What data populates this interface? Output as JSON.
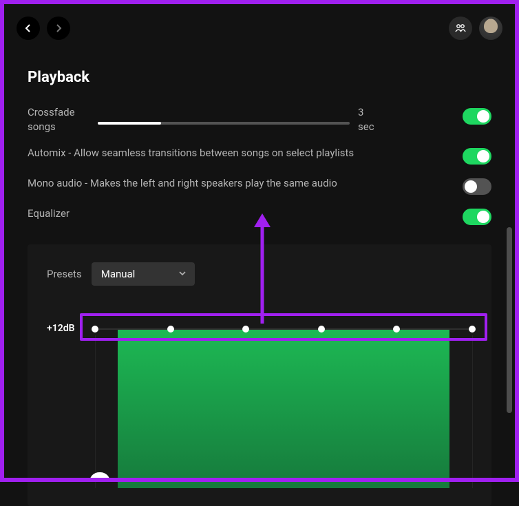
{
  "colors": {
    "accent": "#1ed760",
    "highlight": "#a020f0"
  },
  "playback": {
    "title": "Playback",
    "crossfade": {
      "label": "Crossfade songs",
      "value_text": "3",
      "unit": "sec",
      "value": 3,
      "min": 0,
      "max": 12
    },
    "automix": {
      "label": "Automix - Allow seamless transitions between songs on select playlists",
      "enabled": true
    },
    "mono": {
      "label": "Mono audio - Makes the left and right speakers play the same audio",
      "enabled": false
    },
    "equalizer": {
      "label": "Equalizer",
      "enabled": true,
      "presets_label": "Presets",
      "preset_selected": "Manual",
      "db_top_label": "+12dB",
      "bands": [
        {
          "gain_db": 12
        },
        {
          "gain_db": 12
        },
        {
          "gain_db": 12
        },
        {
          "gain_db": 12
        },
        {
          "gain_db": 12
        },
        {
          "gain_db": 12
        }
      ]
    }
  }
}
